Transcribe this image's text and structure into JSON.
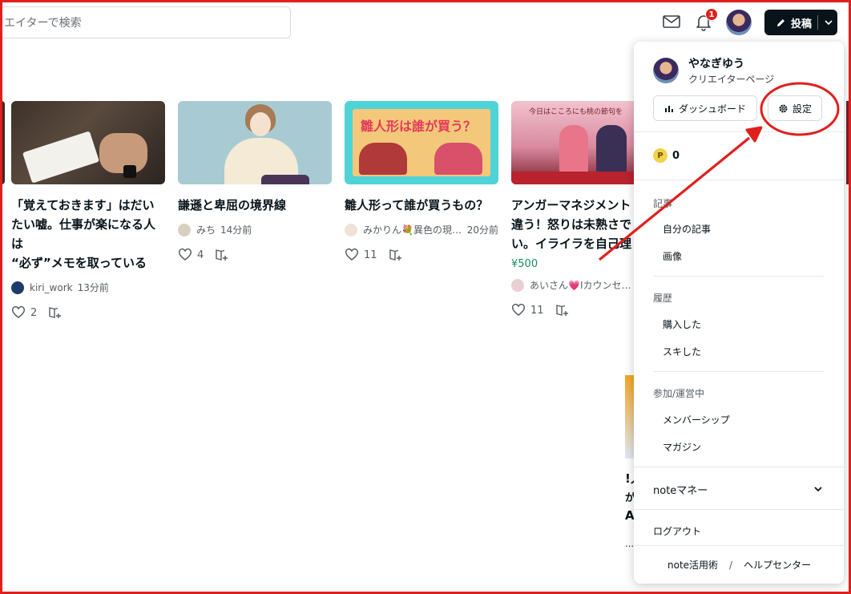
{
  "header": {
    "search_placeholder": "エイターで検索",
    "notification_count": "1",
    "post_label": "投稿"
  },
  "cards": [
    {
      "title": "「覚えておきます」はだいたい嘘。仕事が楽になる人は\n“必ず”メモを取っている",
      "author": "kiri_work",
      "time": "13分前",
      "likes": "2"
    },
    {
      "title": "謙遜と卑屈の境界線",
      "author": "みち",
      "time": "14分前",
      "likes": "4"
    },
    {
      "title": "雛人形って誰が買うもの？",
      "thumb_text": "雛人形は誰が買う？",
      "author": "みかりん💐異色の現…",
      "time": "20分前",
      "likes": "11"
    },
    {
      "title": "アンガーマネジメント\n違う！怒りは未熟さで\nい。イライラを自己理",
      "thumb_text": "今日はこころにも桃の節句を",
      "price": "¥500",
      "author": "あいさん💗Iカウンセ…",
      "likes": "11"
    }
  ],
  "background_fragments": [
    "!人",
    "が",
    "A",
    "…"
  ],
  "menu": {
    "user_name": "やなぎゆう",
    "creator_page": "クリエイターページ",
    "dashboard": "ダッシュボード",
    "settings": "設定",
    "points": "0",
    "coin_symbol": "P",
    "sections": [
      {
        "label": "記事",
        "items": [
          "自分の記事",
          "画像"
        ]
      },
      {
        "label": "履歴",
        "items": [
          "購入した",
          "スキした"
        ]
      },
      {
        "label": "参加/運営中",
        "items": [
          "メンバーシップ",
          "マガジン"
        ]
      }
    ],
    "money": "noteマネー",
    "logout": "ログアウト",
    "footer_left": "note活用術",
    "footer_sep": "/",
    "footer_right": "ヘルプセンター"
  },
  "colors": {
    "accent_red": "#e0201c",
    "price_green": "#1a8c5e",
    "dark": "#08131a"
  }
}
